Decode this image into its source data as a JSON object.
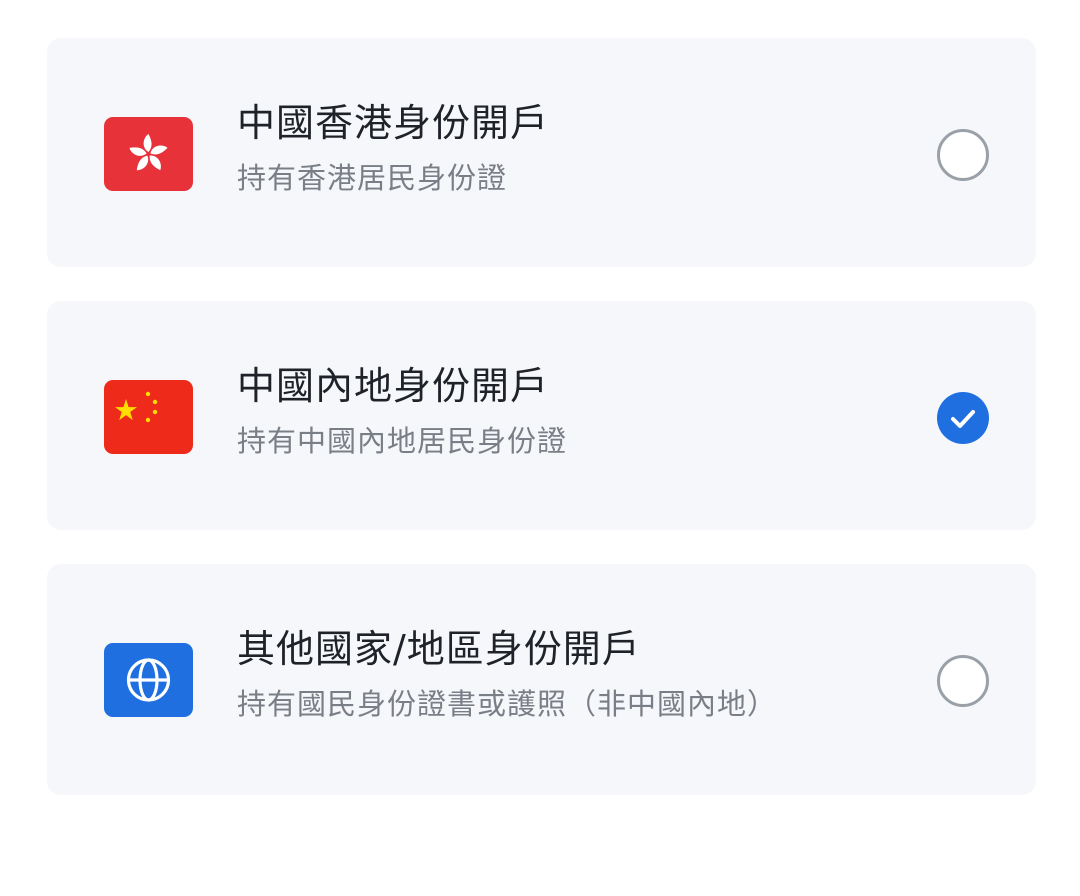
{
  "options": [
    {
      "title": "中國香港身份開戶",
      "subtitle": "持有香港居民身份證",
      "icon": "hong-kong-flag-icon",
      "selected": false
    },
    {
      "title": "中國內地身份開戶",
      "subtitle": "持有中國內地居民身份證",
      "icon": "china-flag-icon",
      "selected": true
    },
    {
      "title": "其他國家/地區身份開戶",
      "subtitle": "持有國民身份證書或護照（非中國內地）",
      "icon": "globe-icon",
      "selected": false
    }
  ],
  "colors": {
    "card_background": "#f5f7fa",
    "accent": "#1f6fe0",
    "hk_red": "#e8323a",
    "cn_red": "#ee2a1b",
    "cn_star": "#ffde00",
    "title_text": "#1f2329",
    "subtitle_text": "#7a7f87"
  }
}
